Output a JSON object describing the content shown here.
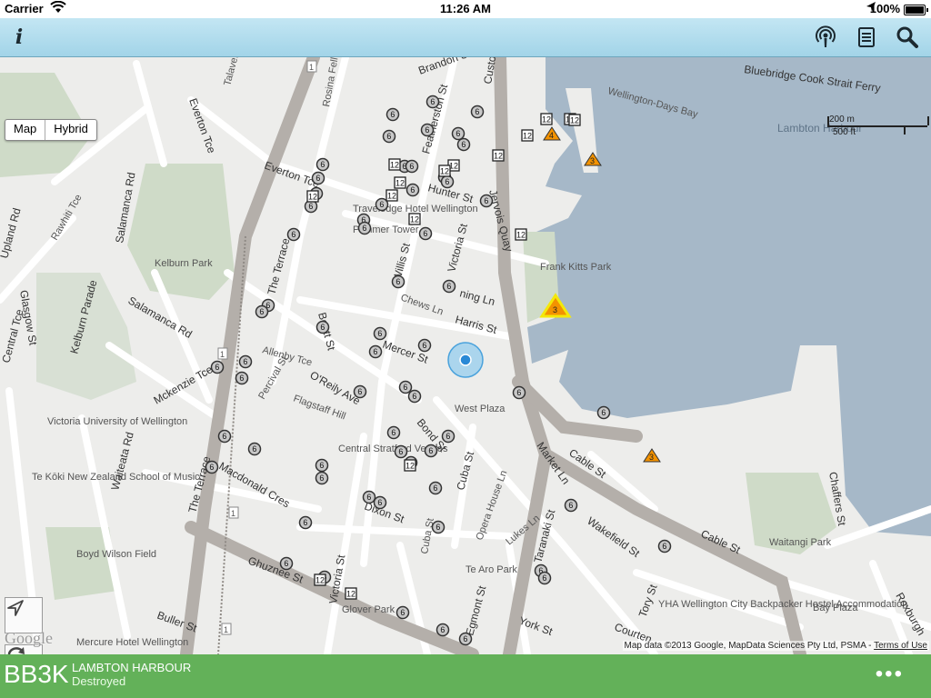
{
  "status_bar": {
    "carrier": "Carrier",
    "time": "11:26 AM",
    "battery": "100%"
  },
  "toolbar": {
    "info_icon": "info-icon",
    "podcast_icon": "podcast-icon",
    "list_icon": "list-icon",
    "search_icon": "search-icon"
  },
  "map": {
    "type_buttons": [
      "Map",
      "Hybrid"
    ],
    "scale": {
      "metric": "200 m",
      "imperial": "500 ft"
    },
    "google_logo": "Google",
    "attribution": "Map data ©2013 Google, MapData Sciences Pty Ltd, PSMA - ",
    "terms_link": "Terms of Use",
    "water_color": "#a6b8c8",
    "park_color": "#cfdbc8",
    "road_major_color": "#b4afaa",
    "labels": {
      "lambton_harbour": "Lambton Harbour",
      "bluebridge": "Bluebridge Cook Strait Ferry",
      "wellington_days_bay": "Wellington-Days Bay",
      "brandon_st": "Brandon St",
      "everton_tce": "Everton Tce",
      "featherston_st": "Featherston St",
      "hunter_st": "Hunter St",
      "travelodge": "Travelodge Hotel Wellington",
      "plimmer_tower": "Plimmer Tower",
      "jervois_quay": "Jervois Quay",
      "willis_st": "Willis St",
      "victoria_st": "Victoria St",
      "the_terrace": "The Terrace",
      "kelburn_park": "Kelburn Park",
      "salamanca_rd": "Salamanca Rd",
      "kelburn_parade": "Kelburn Parade",
      "frank_kitts_park": "Frank Kitts Park",
      "harris_st": "Harris St",
      "mercer_st": "Mercer St",
      "boott_st": "Boott St",
      "oreily_ave": "O'Reily Ave",
      "west_plaza": "West Plaza",
      "victoria_university": "Victoria University of Wellington",
      "te_koki": "Te Kōki New Zealand School of Music",
      "central_stratford": "Central Stratford Venues",
      "macdonald_cres": "Macdonald Cres",
      "dixon_st": "Dixon St",
      "cuba_st": "Cuba St",
      "opera_house_ln": "Opera House Ln",
      "taranaki_st": "Taranaki St",
      "cable_st": "Cable St",
      "wakefield_st": "Wakefield St",
      "market_ln": "Market Ln",
      "waitangi_park": "Waitangi Park",
      "te_aro_park": "Te Aro Park",
      "ghuznee_st": "Ghuznee St",
      "glover_park": "Glover Park",
      "boyd_wilson_field": "Boyd Wilson Field",
      "yha": "YHA Wellington City Backpacker Hostel Accommodation",
      "bay_plaza": "Bay Plaza",
      "roxburgh": "Roxburgh",
      "chaffers_st": "Chaffers St",
      "tory_st": "Tory St",
      "courtenay": "Courten",
      "york_st": "York St",
      "egmont_st": "Egmont St",
      "buller_st": "Buller St",
      "mercure": "Mercure Hotel Wellington",
      "glasgow_st": "Glasgow St",
      "mckenzie_tce": "Mckenzie Tce",
      "waiteata_rd": "Waiteata Rd",
      "rawhiti_tce": "Rawhiti Tce",
      "upland_rd": "Upland Rd",
      "central_tce": "Central Tce",
      "talavera_tce": "Talavera Tce",
      "rosina_fell": "Rosina Fell",
      "custom_house": "Custom",
      "allenby_tce": "Allenby Tce",
      "percival_st": "Percival St",
      "flagstaff_hill": "Flagstaff Hill",
      "bond_st": "Bond St",
      "manning_ln": "ning Ln",
      "chews_ln": "Chews Ln",
      "lukes_ln": "Lukes Ln",
      "the_terrace2": "The Terrace",
      "victoria_st2": "Victoria St",
      "cuba_st2": "Cuba St"
    },
    "markers": {
      "bus_stop_label": "6",
      "number_label": "12",
      "hazard_label_4": "4",
      "hazard_label_3": "3",
      "route_label": "1",
      "current_location": "current-location-marker"
    }
  },
  "bottom_bar": {
    "code": "BB3K",
    "place": "LAMBTON HARBOUR",
    "status": "Destroyed",
    "more": "•••"
  }
}
